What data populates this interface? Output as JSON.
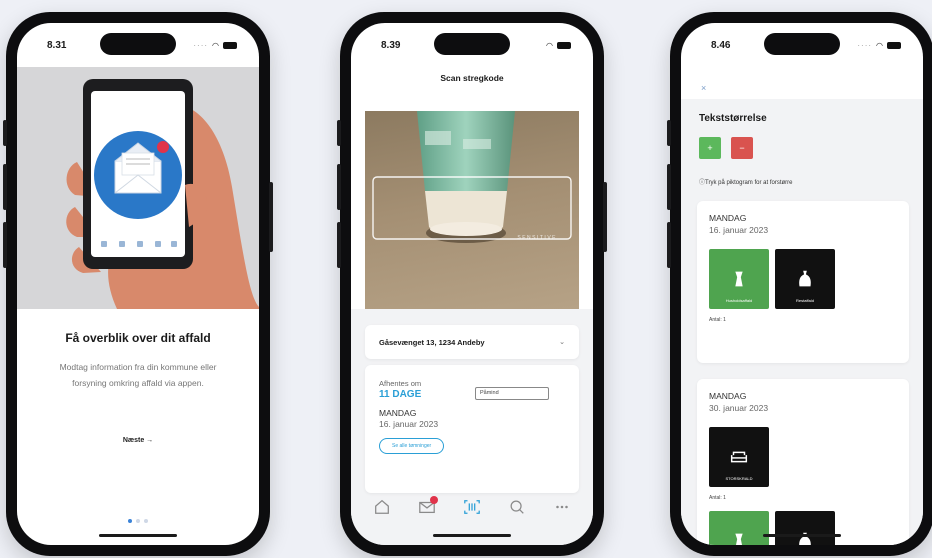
{
  "phone1": {
    "status_time": "8.31",
    "title": "Få overblik over dit affald",
    "description": "Modtag information fra din kommune eller forsyning omkring affald via appen.",
    "next_label": "Næste"
  },
  "phone2": {
    "status_time": "8.39",
    "header": "Scan stregkode",
    "address": "Gåsevænget 13, 1234 Andeby",
    "pickup_label": "Afhentes om",
    "days": "11 DAGE",
    "reminder_label": "Påmind",
    "day": "MANDAG",
    "date": "16. januar 2023",
    "link_label": "Se alle tømninger",
    "camera_text": "SENSITIVE"
  },
  "phone3": {
    "status_time": "8.46",
    "close_label": "×",
    "title": "Tekststørrelse",
    "plus_label": "+",
    "minus_label": "−",
    "hint": "Tryk på piktogram for at forstørre",
    "card1": {
      "day": "MANDAG",
      "date": "16. januar 2023",
      "tile1_label": "Husholdsaffald",
      "tile2_label": "Restaffald",
      "count": "Antal: 1"
    },
    "card2": {
      "day": "MANDAG",
      "date": "30. januar 2023",
      "tile1_label": "STORSKRALD",
      "count": "Antal: 1"
    }
  },
  "colors": {
    "accent": "#2a9fd6",
    "green": "#4fa44f",
    "badge": "#e0334a",
    "background": "#eef0f6"
  },
  "icons": [
    "home-icon",
    "mail-icon",
    "barcode-icon",
    "search-icon",
    "more-icon",
    "wifi-icon",
    "battery-icon"
  ]
}
